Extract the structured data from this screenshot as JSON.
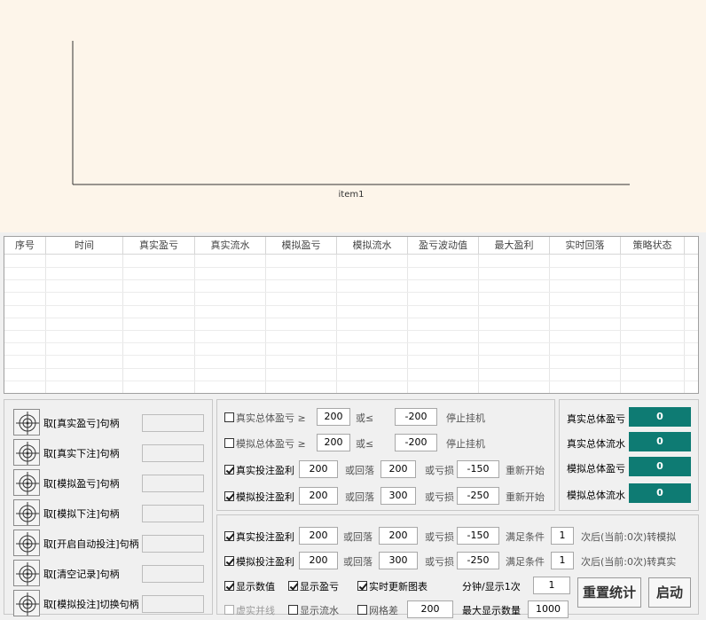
{
  "chart_data": {
    "type": "line",
    "categories": [
      "item1"
    ],
    "series": [],
    "title": "",
    "xlabel": "",
    "ylabel": ""
  },
  "table": {
    "columns": [
      "序号",
      "时间",
      "真实盈亏",
      "真实流水",
      "模拟盈亏",
      "模拟流水",
      "盈亏波动值",
      "最大盈利",
      "实时回落",
      "策略状态"
    ],
    "rows": []
  },
  "handles": [
    {
      "label": "取[真实盈亏]句柄",
      "value": ""
    },
    {
      "label": "取[真实下注]句柄",
      "value": ""
    },
    {
      "label": "取[模拟盈亏]句柄",
      "value": ""
    },
    {
      "label": "取[模拟下注]句柄",
      "value": ""
    },
    {
      "label": "取[开启自动投注]句柄",
      "value": ""
    },
    {
      "label": "取[清空记录]句柄",
      "value": ""
    },
    {
      "label": "取[模拟投注]切换句柄",
      "value": ""
    }
  ],
  "strategy1": {
    "row1": {
      "label": "真实总体盈亏",
      "checked": false,
      "ge": "≥",
      "v1": "200",
      "or": "或≤",
      "v2": "-200",
      "action": "停止挂机"
    },
    "row2": {
      "label": "模拟总体盈亏",
      "checked": false,
      "ge": "≥",
      "v1": "200",
      "or": "或≤",
      "v2": "-200",
      "action": "停止挂机"
    },
    "row3": {
      "label": "真实投注盈利",
      "checked": true,
      "v1": "200",
      "mid": "或回落",
      "v2": "200",
      "loss": "或亏损",
      "v3": "-150",
      "action": "重新开始"
    },
    "row4": {
      "label": "模拟投注盈利",
      "checked": true,
      "v1": "200",
      "mid": "或回落",
      "v2": "300",
      "loss": "或亏损",
      "v3": "-250",
      "action": "重新开始"
    }
  },
  "totals": [
    {
      "label": "真实总体盈亏",
      "value": "0"
    },
    {
      "label": "真实总体流水",
      "value": "0"
    },
    {
      "label": "模拟总体盈亏",
      "value": "0"
    },
    {
      "label": "模拟总体流水",
      "value": "0"
    }
  ],
  "strategy2": {
    "row1": {
      "label": "真实投注盈利",
      "checked": true,
      "v1": "200",
      "mid": "或回落",
      "v2": "200",
      "loss": "或亏损",
      "v3": "-150",
      "cond": "满足条件",
      "n": "1",
      "suffix": "次后(当前:0次)转模拟"
    },
    "row2": {
      "label": "模拟投注盈利",
      "checked": true,
      "v1": "200",
      "mid": "或回落",
      "v2": "300",
      "loss": "或亏损",
      "v3": "-250",
      "cond": "满足条件",
      "n": "1",
      "suffix": "次后(当前:0次)转真实"
    },
    "show_values": {
      "label": "显示数值",
      "checked": true
    },
    "show_pnl": {
      "label": "显示盈亏",
      "checked": true
    },
    "realtime": {
      "label": "实时更新图表",
      "checked": true
    },
    "interval_label": "分钟/显示1次",
    "interval_value": "1",
    "dashed": {
      "label": "虚实并线",
      "checked": false
    },
    "show_flow": {
      "label": "显示流水",
      "checked": false
    },
    "grid_diff": {
      "label": "网格差",
      "checked": false,
      "value": "200"
    },
    "max_label": "最大显示数量",
    "max_value": "1000"
  },
  "buttons": {
    "reset": "重置统计",
    "start": "启动"
  },
  "icons": {
    "target": "crosshair-target-icon"
  }
}
